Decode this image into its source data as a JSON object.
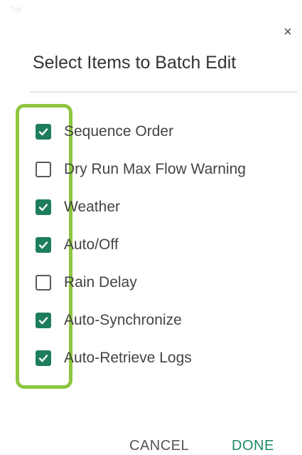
{
  "dialog": {
    "title": "Select Items to Batch Edit",
    "close_glyph": "×",
    "corner_text": "Tar"
  },
  "items": [
    {
      "label": "Sequence Order",
      "checked": true
    },
    {
      "label": "Dry Run Max Flow Warning",
      "checked": false
    },
    {
      "label": "Weather",
      "checked": true
    },
    {
      "label": "Auto/Off",
      "checked": true
    },
    {
      "label": "Rain Delay",
      "checked": false
    },
    {
      "label": "Auto-Synchronize",
      "checked": true
    },
    {
      "label": "Auto-Retrieve Logs",
      "checked": true
    }
  ],
  "actions": {
    "cancel_label": "CANCEL",
    "done_label": "DONE"
  },
  "colors": {
    "checkbox_checked": "#1e7d5e",
    "highlight_outline": "#8dc63f",
    "done_text": "#1e8a63"
  },
  "icons": {
    "close": "close-icon",
    "checked": "checkmark-icon"
  }
}
